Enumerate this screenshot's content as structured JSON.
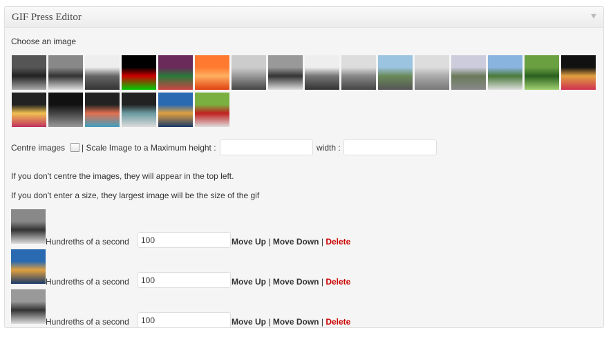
{
  "panel": {
    "title": "GIF Press Editor"
  },
  "chooser": {
    "label": "Choose an image",
    "images": [
      {
        "name": "bw-tree-house",
        "colors": [
          "#555",
          "#222",
          "#aaa"
        ]
      },
      {
        "name": "bw-palm-house",
        "colors": [
          "#888",
          "#333",
          "#ddd"
        ]
      },
      {
        "name": "bw-building",
        "colors": [
          "#eee",
          "#666",
          "#333"
        ]
      },
      {
        "name": "rock-state-university",
        "colors": [
          "#000",
          "#c00",
          "#0c0"
        ]
      },
      {
        "name": "flowers-color",
        "colors": [
          "#6a2a5a",
          "#2a7a3a",
          "#c44"
        ]
      },
      {
        "name": "orange-sun",
        "colors": [
          "#ff7a30",
          "#ffb060",
          "#e04010"
        ]
      },
      {
        "name": "bw-car",
        "colors": [
          "#ccc",
          "#999",
          "#444"
        ]
      },
      {
        "name": "bw-street",
        "colors": [
          "#999",
          "#333",
          "#ddd"
        ]
      },
      {
        "name": "bw-trees",
        "colors": [
          "#eee",
          "#777",
          "#333"
        ]
      },
      {
        "name": "bw-road",
        "colors": [
          "#ddd",
          "#888",
          "#444"
        ]
      },
      {
        "name": "highway-color",
        "colors": [
          "#9bc4e0",
          "#6a8a5a",
          "#555"
        ]
      },
      {
        "name": "blossom-tree",
        "colors": [
          "#ddd",
          "#aaa",
          "#777"
        ]
      },
      {
        "name": "railway",
        "colors": [
          "#ccd",
          "#6a7a5a",
          "#888"
        ]
      },
      {
        "name": "monument",
        "colors": [
          "#8ab4e0",
          "#4a7a3a",
          "#ddd"
        ]
      },
      {
        "name": "green-leaves",
        "colors": [
          "#6aa040",
          "#2a6020",
          "#a0d070"
        ]
      },
      {
        "name": "graffiti-1",
        "colors": [
          "#111",
          "#e0a040",
          "#d03050"
        ]
      },
      {
        "name": "graffiti-2",
        "colors": [
          "#222",
          "#f0c050",
          "#c03060"
        ]
      },
      {
        "name": "billboard-dark",
        "colors": [
          "#111",
          "#444",
          "#999"
        ]
      },
      {
        "name": "graffiti-3",
        "colors": [
          "#222",
          "#e07050",
          "#40a0c0"
        ]
      },
      {
        "name": "library-congress",
        "colors": [
          "#222",
          "#6a9aa0",
          "#ddd"
        ]
      },
      {
        "name": "mural-color",
        "colors": [
          "#2a6ab0",
          "#e0a040",
          "#1a3a6a"
        ]
      },
      {
        "name": "person-red",
        "colors": [
          "#7ab040",
          "#c02020",
          "#ddd"
        ]
      }
    ]
  },
  "options": {
    "centre_label": "Centre images",
    "scale_label": "| Scale Image to a Maximum height :",
    "height_value": "",
    "width_label": "width :",
    "width_value": ""
  },
  "info": {
    "line1": "If you don't centre the images, they will appear in the top left.",
    "line2": "If you don't enter a size, they largest image will be the size of the gif"
  },
  "frames": [
    {
      "thumb": "bw-palm-house",
      "label": "Hundreths of a second",
      "value": "100",
      "move_up": "Move Up",
      "sep1": "|",
      "move_down": "Move Down",
      "sep2": "|",
      "delete": "Delete"
    },
    {
      "thumb": "mural-color",
      "label": "Hundreths of a second",
      "value": "100",
      "move_up": "Move Up",
      "sep1": "|",
      "move_down": "Move Down",
      "sep2": "|",
      "delete": "Delete"
    },
    {
      "thumb": "bw-street",
      "label": "Hundreths of a second",
      "value": "100",
      "move_up": "Move Up",
      "sep1": "|",
      "move_down": "Move Down",
      "sep2": "|",
      "delete": "Delete"
    }
  ]
}
